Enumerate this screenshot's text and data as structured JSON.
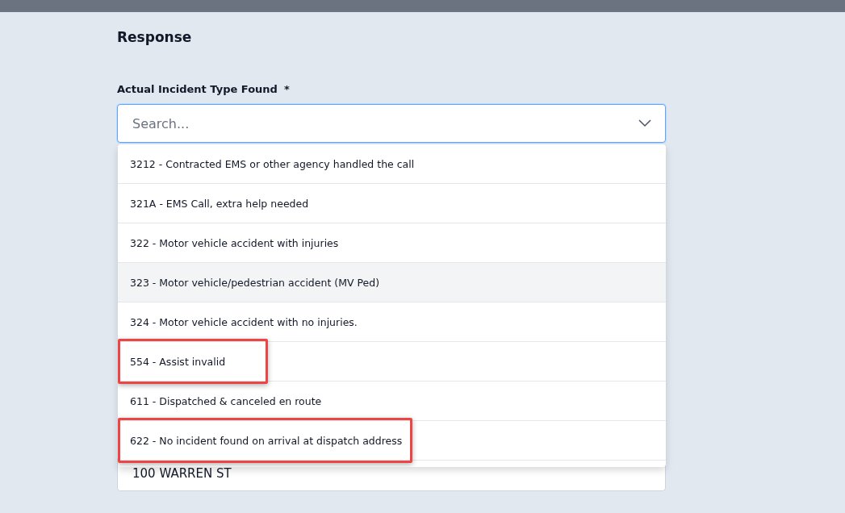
{
  "section_title": "Response",
  "field": {
    "label": "Actual Incident Type Found",
    "required_mark": "*",
    "placeholder": "Search...",
    "expanded": true
  },
  "options": [
    {
      "code": "3212",
      "separator": "-",
      "text": "Contracted EMS or other agency handled the call",
      "hovered": false,
      "annotated": false
    },
    {
      "code": "321A",
      "separator": "-",
      "text": "EMS Call, extra help needed",
      "hovered": false,
      "annotated": false
    },
    {
      "code": "322",
      "separator": "-",
      "text": "Motor vehicle accident with injuries",
      "hovered": false,
      "annotated": false
    },
    {
      "code": "323",
      "separator": "-",
      "text": "Motor vehicle/pedestrian accident (MV Ped)",
      "hovered": true,
      "annotated": false
    },
    {
      "code": "324",
      "separator": "-",
      "text": "Motor vehicle accident with no injuries.",
      "hovered": false,
      "annotated": false
    },
    {
      "code": "554",
      "separator": "-",
      "text": "Assist invalid",
      "hovered": false,
      "annotated": true
    },
    {
      "code": "611",
      "separator": "-",
      "text": "Dispatched & canceled en route",
      "hovered": false,
      "annotated": false
    },
    {
      "code": "622",
      "separator": "-",
      "text": "No incident found on arrival at dispatch address",
      "hovered": false,
      "annotated": true
    }
  ],
  "address_field": {
    "value": "100 WARREN ST"
  }
}
